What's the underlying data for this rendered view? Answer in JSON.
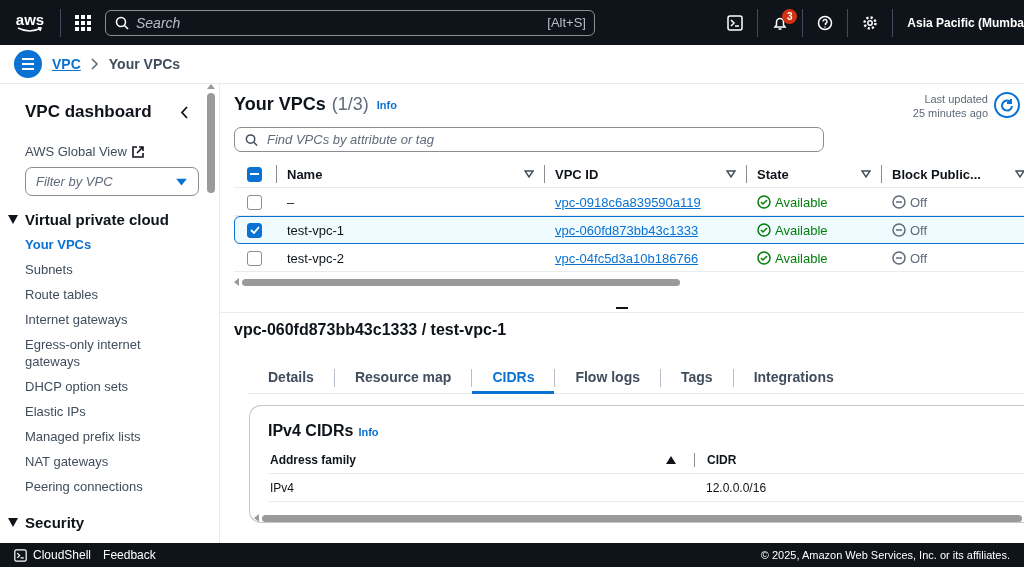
{
  "topbar": {
    "logo": "aws",
    "search": {
      "placeholder": "Search",
      "shortcut": "[Alt+S]"
    },
    "notifications": "3",
    "region": "Asia Pacific (Mumba"
  },
  "breadcrumb": [
    {
      "label": "VPC",
      "link": true
    },
    {
      "label": "Your VPCs",
      "link": false
    }
  ],
  "sidebar": {
    "title": "VPC dashboard",
    "global_view": "AWS Global View",
    "filter": {
      "placeholder": "Filter by VPC"
    },
    "sections": [
      {
        "title": "Virtual private cloud",
        "expanded": true,
        "items": [
          {
            "label": "Your VPCs",
            "selected": true
          },
          {
            "label": "Subnets",
            "selected": false
          },
          {
            "label": "Route tables",
            "selected": false
          },
          {
            "label": "Internet gateways",
            "selected": false
          },
          {
            "label": "Egress-only internet gateways",
            "selected": false
          },
          {
            "label": "DHCP option sets",
            "selected": false
          },
          {
            "label": "Elastic IPs",
            "selected": false
          },
          {
            "label": "Managed prefix lists",
            "selected": false
          },
          {
            "label": "NAT gateways",
            "selected": false
          },
          {
            "label": "Peering connections",
            "selected": false
          }
        ]
      },
      {
        "title": "Security",
        "expanded": true
      }
    ]
  },
  "vpcs": {
    "title": "Your VPCs",
    "count": "(1/3)",
    "info": "Info",
    "last_updated": "Last updated",
    "updated_ago": "25 minutes ago",
    "search": {
      "placeholder": "Find VPCs by attribute or tag"
    },
    "select_all": {
      "checked": true,
      "indeterminate": true
    },
    "columns": [
      "Name",
      "VPC ID",
      "State",
      "Block Public..."
    ],
    "rows": [
      {
        "selected": false,
        "name": "–",
        "vpc_id": "vpc-0918c6a839590a119",
        "state": "Available",
        "block": "Off"
      },
      {
        "selected": true,
        "name": "test-vpc-1",
        "vpc_id": "vpc-060fd873bb43c1333",
        "state": "Available",
        "block": "Off"
      },
      {
        "selected": false,
        "name": "test-vpc-2",
        "vpc_id": "vpc-04fc5d3a10b186766",
        "state": "Available",
        "block": "Off"
      }
    ]
  },
  "details": {
    "title": "vpc-060fd873bb43c1333 / test-vpc-1",
    "tabs": [
      {
        "label": "Details",
        "selected": false
      },
      {
        "label": "Resource map",
        "selected": false
      },
      {
        "label": "CIDRs",
        "selected": true
      },
      {
        "label": "Flow logs",
        "selected": false
      },
      {
        "label": "Tags",
        "selected": false
      },
      {
        "label": "Integrations",
        "selected": false
      }
    ],
    "card": {
      "title": "IPv4 CIDRs",
      "info": "Info",
      "columns": [
        "Address family",
        "CIDR"
      ],
      "rows": [
        [
          "IPv4",
          "12.0.0.0/16"
        ]
      ]
    }
  },
  "footer": {
    "cloudshell": "CloudShell",
    "feedback": "Feedback",
    "copyright": "© 2025, Amazon Web Services, Inc. or its affiliates."
  }
}
